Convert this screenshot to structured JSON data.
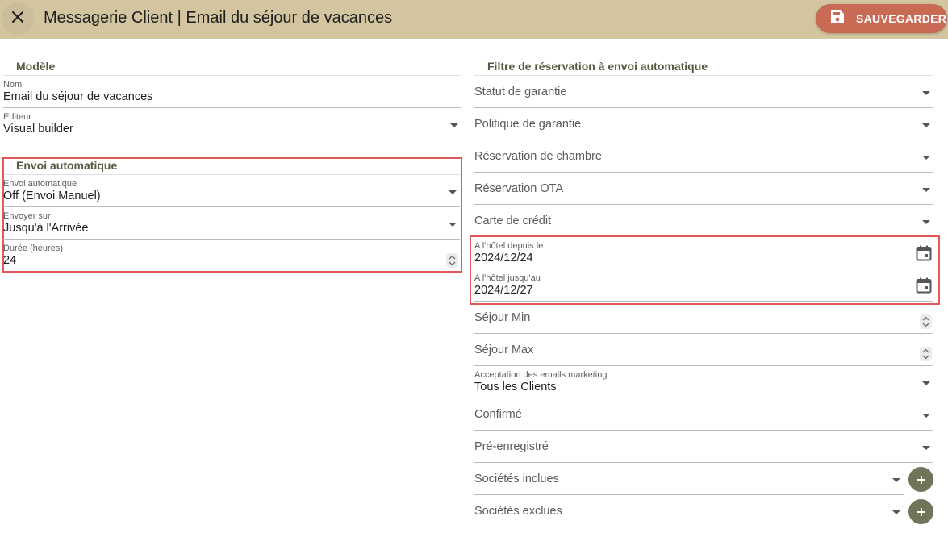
{
  "header": {
    "title": "Messagerie Client | Email du séjour de vacances",
    "save_label": "SAUVEGARDER",
    "close_icon": "close-icon",
    "save_icon": "floppy-disk-icon",
    "bar_color": "#d4c5a1",
    "save_color": "#c96a55"
  },
  "left": {
    "model_section": {
      "title": "Modèle",
      "name": {
        "label": "Nom",
        "value": "Email du séjour de vacances"
      },
      "editor": {
        "label": "Editeur",
        "value": "Visual builder"
      }
    },
    "auto_section": {
      "title": "Envoi automatique",
      "auto_send": {
        "label": "Envoi automatique",
        "value": "Off (Envoi Manuel)"
      },
      "send_on": {
        "label": "Envoyer sur",
        "value": "Jusqu'à l'Arrivée"
      },
      "duration": {
        "label": "Durée (heures)",
        "value": "24"
      }
    }
  },
  "right": {
    "title": "Filtre de réservation à envoi automatique",
    "guarantee_status": "Statut de garantie",
    "guarantee_policy": "Politique de garantie",
    "room_reservation": "Réservation de chambre",
    "ota_reservation": "Réservation OTA",
    "credit_card": "Carte de crédit",
    "hotel_from": {
      "label": "A l'hôtel depuis le",
      "value": "2024/12/24"
    },
    "hotel_until": {
      "label": "A l'hôtel jusqu'au",
      "value": "2024/12/27"
    },
    "stay_min": "Séjour Min",
    "stay_max": "Séjour Max",
    "marketing": {
      "label": "Acceptation des emails marketing",
      "value": "Tous les Clients"
    },
    "confirmed": "Confirmé",
    "prereg": "Pré-enregistré",
    "companies_included": "Sociétés inclues",
    "companies_excluded": "Sociétés exclues"
  },
  "highlight_color": "#e05858",
  "accent_green": "#6f7559"
}
